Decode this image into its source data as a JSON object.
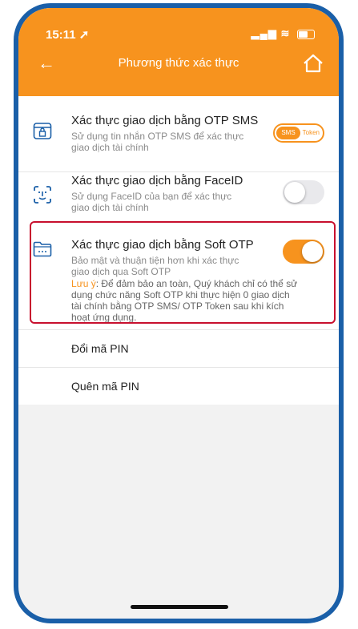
{
  "status_bar": {
    "time": "15:11",
    "location_arrow": "➚",
    "signal": "▂▄▆",
    "wifi": "≋"
  },
  "header": {
    "back_icon": "←",
    "title": "Phương thức xác thực",
    "home_icon": "home-icon"
  },
  "settings": {
    "otp_sms": {
      "title": "Xác thực giao dịch bằng OTP SMS",
      "desc_line1": "Sử dụng tin nhắn OTP SMS để xác thực",
      "desc_line2": "giao dịch tài chính",
      "toggle_left": "SMS",
      "toggle_right": "Token"
    },
    "face_id": {
      "title": "Xác thực giao dịch bằng FaceID",
      "desc_line1": "Sử dụng FaceID của bạn để xác thực",
      "desc_line2": "giao dịch tài chính",
      "enabled": false
    },
    "soft_otp": {
      "title": "Xác thực giao dịch bằng Soft OTP",
      "desc_line1": "Bảo mật và thuận tiện hơn khi xác thực",
      "desc_line2": "giao dịch qua Soft OTP",
      "note_label": "Lưu ý",
      "note_line1": ": Để đảm bảo an toàn, Quý khách chỉ có thể sử",
      "note_line2": "dụng chức năng Soft OTP khi thực hiện 0 giao dịch",
      "note_line3": "tài chính bằng OTP SMS/ OTP Token sau khi kích",
      "note_line4": "hoạt ứng dụng.",
      "enabled": true
    },
    "change_pin": "Đổi mã PIN",
    "forgot_pin": "Quên mã PIN"
  },
  "colors": {
    "accent": "#f7931e",
    "frame": "#1a5fa8",
    "highlight_border": "#c8102e"
  }
}
